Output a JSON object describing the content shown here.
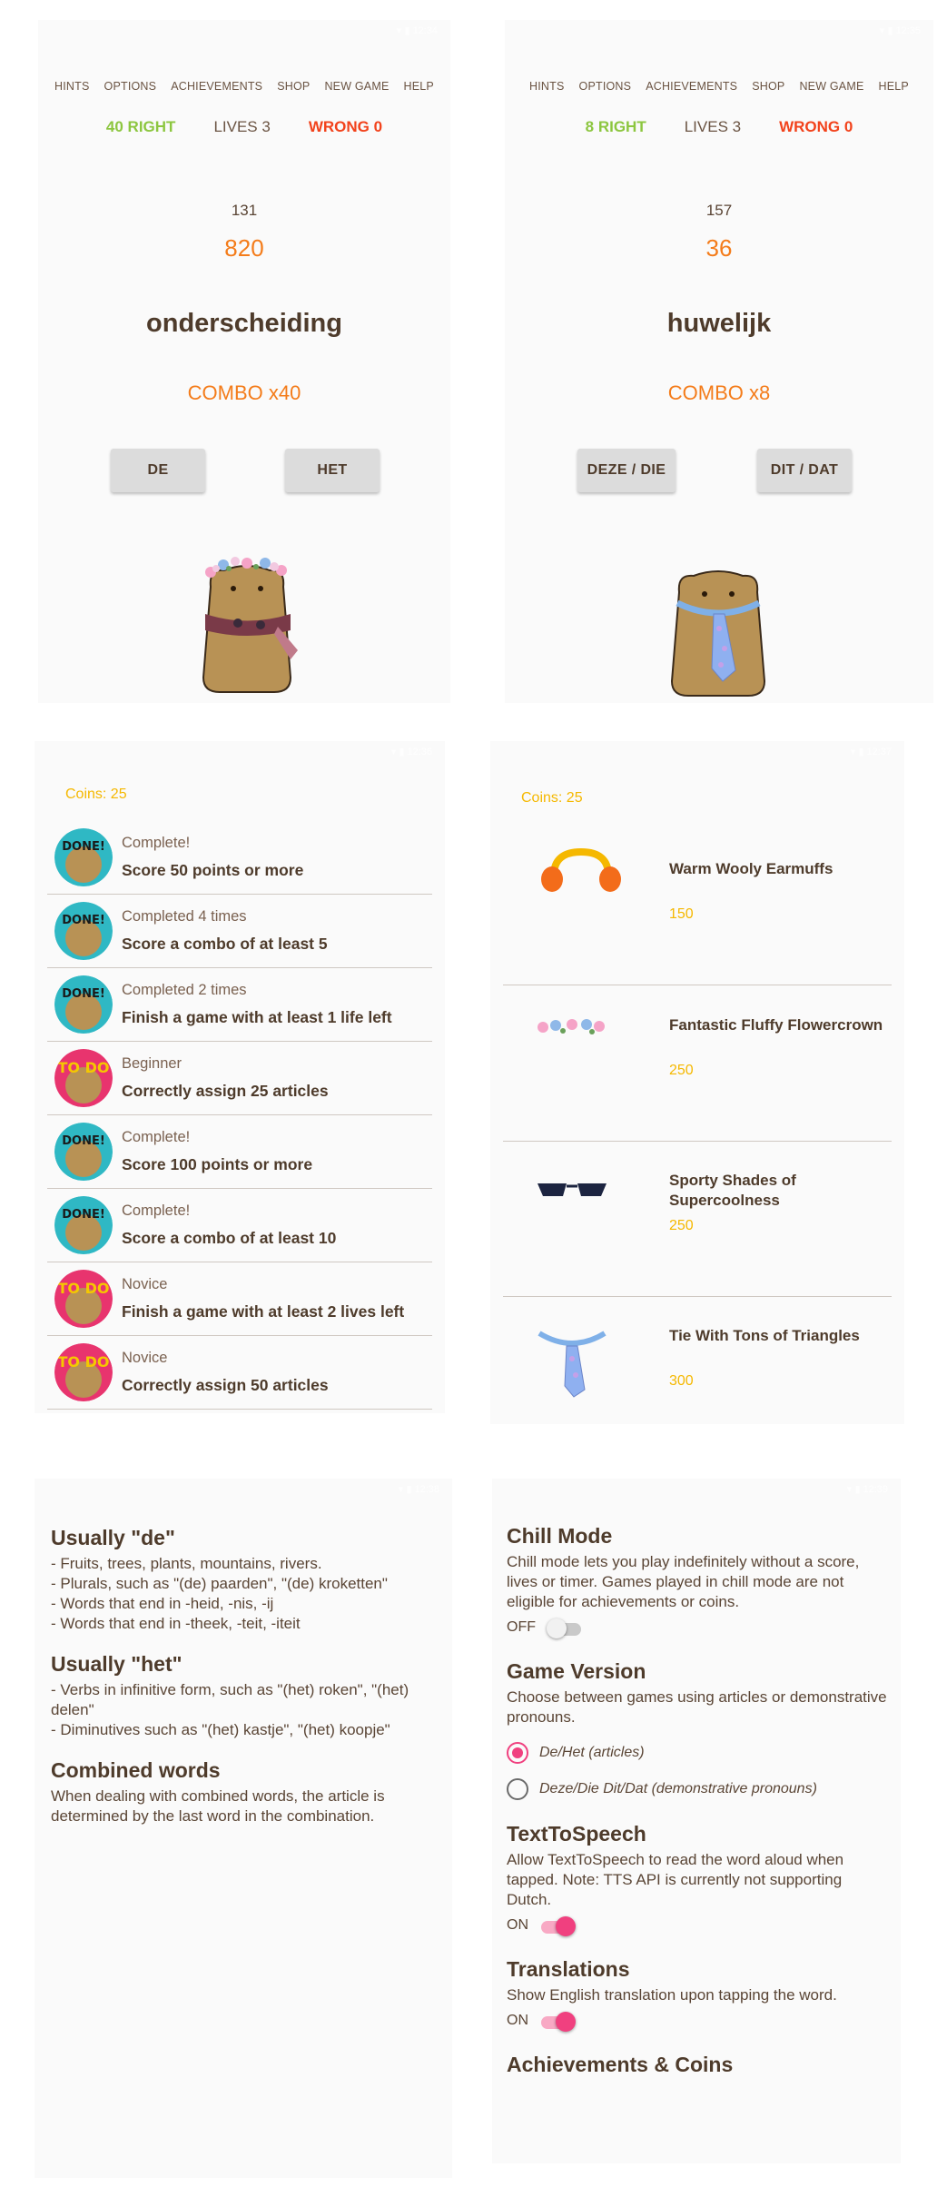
{
  "menu": [
    "HINTS",
    "OPTIONS",
    "ACHIEVEMENTS",
    "SHOP",
    "NEW GAME",
    "HELP"
  ],
  "game1": {
    "right": "40 RIGHT",
    "lives": "LIVES 3",
    "wrong": "WRONG 0",
    "count": "131",
    "score": "820",
    "word": "onderscheiding",
    "combo": "COMBO x40",
    "btn_left": "DE",
    "btn_right": "HET"
  },
  "game2": {
    "right": "8 RIGHT",
    "lives": "LIVES 3",
    "wrong": "WRONG 0",
    "count": "157",
    "score": "36",
    "word": "huwelijk",
    "combo": "COMBO x8",
    "btn_left": "DEZE / DIE",
    "btn_right": "DIT / DAT"
  },
  "achievements": {
    "coins": "Coins: 25",
    "items": [
      {
        "status": "Complete!",
        "title": "Score 50 points or more",
        "badge": "done-badge"
      },
      {
        "status": "Completed 4 times",
        "title": "Score a combo of at least 5",
        "badge": "done-badge"
      },
      {
        "status": "Completed 2 times",
        "title": "Finish a game with at least 1 life left",
        "badge": "done-badge"
      },
      {
        "status": "Beginner",
        "title": "Correctly assign 25 articles",
        "badge": "todo-badge"
      },
      {
        "status": "Complete!",
        "title": "Score 100 points or more",
        "badge": "done-badge"
      },
      {
        "status": "Complete!",
        "title": "Score a combo of at least 10",
        "badge": "done-badge"
      },
      {
        "status": "Novice",
        "title": "Finish a game with at least 2 lives left",
        "badge": "todo-badge"
      },
      {
        "status": "Novice",
        "title": "Correctly assign 50 articles",
        "badge": "todo-badge"
      }
    ]
  },
  "shop": {
    "coins": "Coins: 25",
    "items": [
      {
        "name": "Warm Wooly Earmuffs",
        "price": "150",
        "icon": "earmuffs-icon"
      },
      {
        "name": "Fantastic Fluffy Flowercrown",
        "price": "250",
        "icon": "flowercrown-icon"
      },
      {
        "name": "Sporty Shades of Supercoolness",
        "price": "250",
        "icon": "sunglasses-icon"
      },
      {
        "name": "Tie With Tons of Triangles",
        "price": "300",
        "icon": "tie-icon"
      }
    ]
  },
  "hints": {
    "de_title": "Usually \"de\"",
    "de_lines": [
      "- Fruits, trees, plants, mountains, rivers.",
      "- Plurals, such as \"(de) paarden\", \"(de) kroketten\"",
      "- Words that end in -heid, -nis, -ij",
      "- Words that end in -theek, -teit, -iteit"
    ],
    "het_title": "Usually \"het\"",
    "het_lines": [
      "- Verbs in infinitive form, such as \"(het) roken\", \"(het) delen\"",
      "- Diminutives such as \"(het) kastje\", \"(het) koopje\""
    ],
    "comb_title": "Combined words",
    "comb_text": "When dealing with combined words, the article is determined by the last word in the combination."
  },
  "options": {
    "chill_title": "Chill Mode",
    "chill_desc": "Chill mode lets you play indefinitely without a score, lives or timer. Games played in chill mode are not eligible for achievements or coins.",
    "chill_state": "OFF",
    "version_title": "Game Version",
    "version_desc": "Choose between games using articles or demonstrative pronouns.",
    "version_opt1": "De/Het (articles)",
    "version_opt2": "Deze/Die Dit/Dat (demonstrative pronouns)",
    "tts_title": "TextToSpeech",
    "tts_desc": "Allow TextToSpeech to read the word aloud when tapped. Note: TTS API is currently not supporting Dutch.",
    "tts_state": "ON",
    "trans_title": "Translations",
    "trans_desc": "Show English translation upon tapping the word.",
    "trans_state": "ON",
    "ach_title": "Achievements & Coins"
  }
}
